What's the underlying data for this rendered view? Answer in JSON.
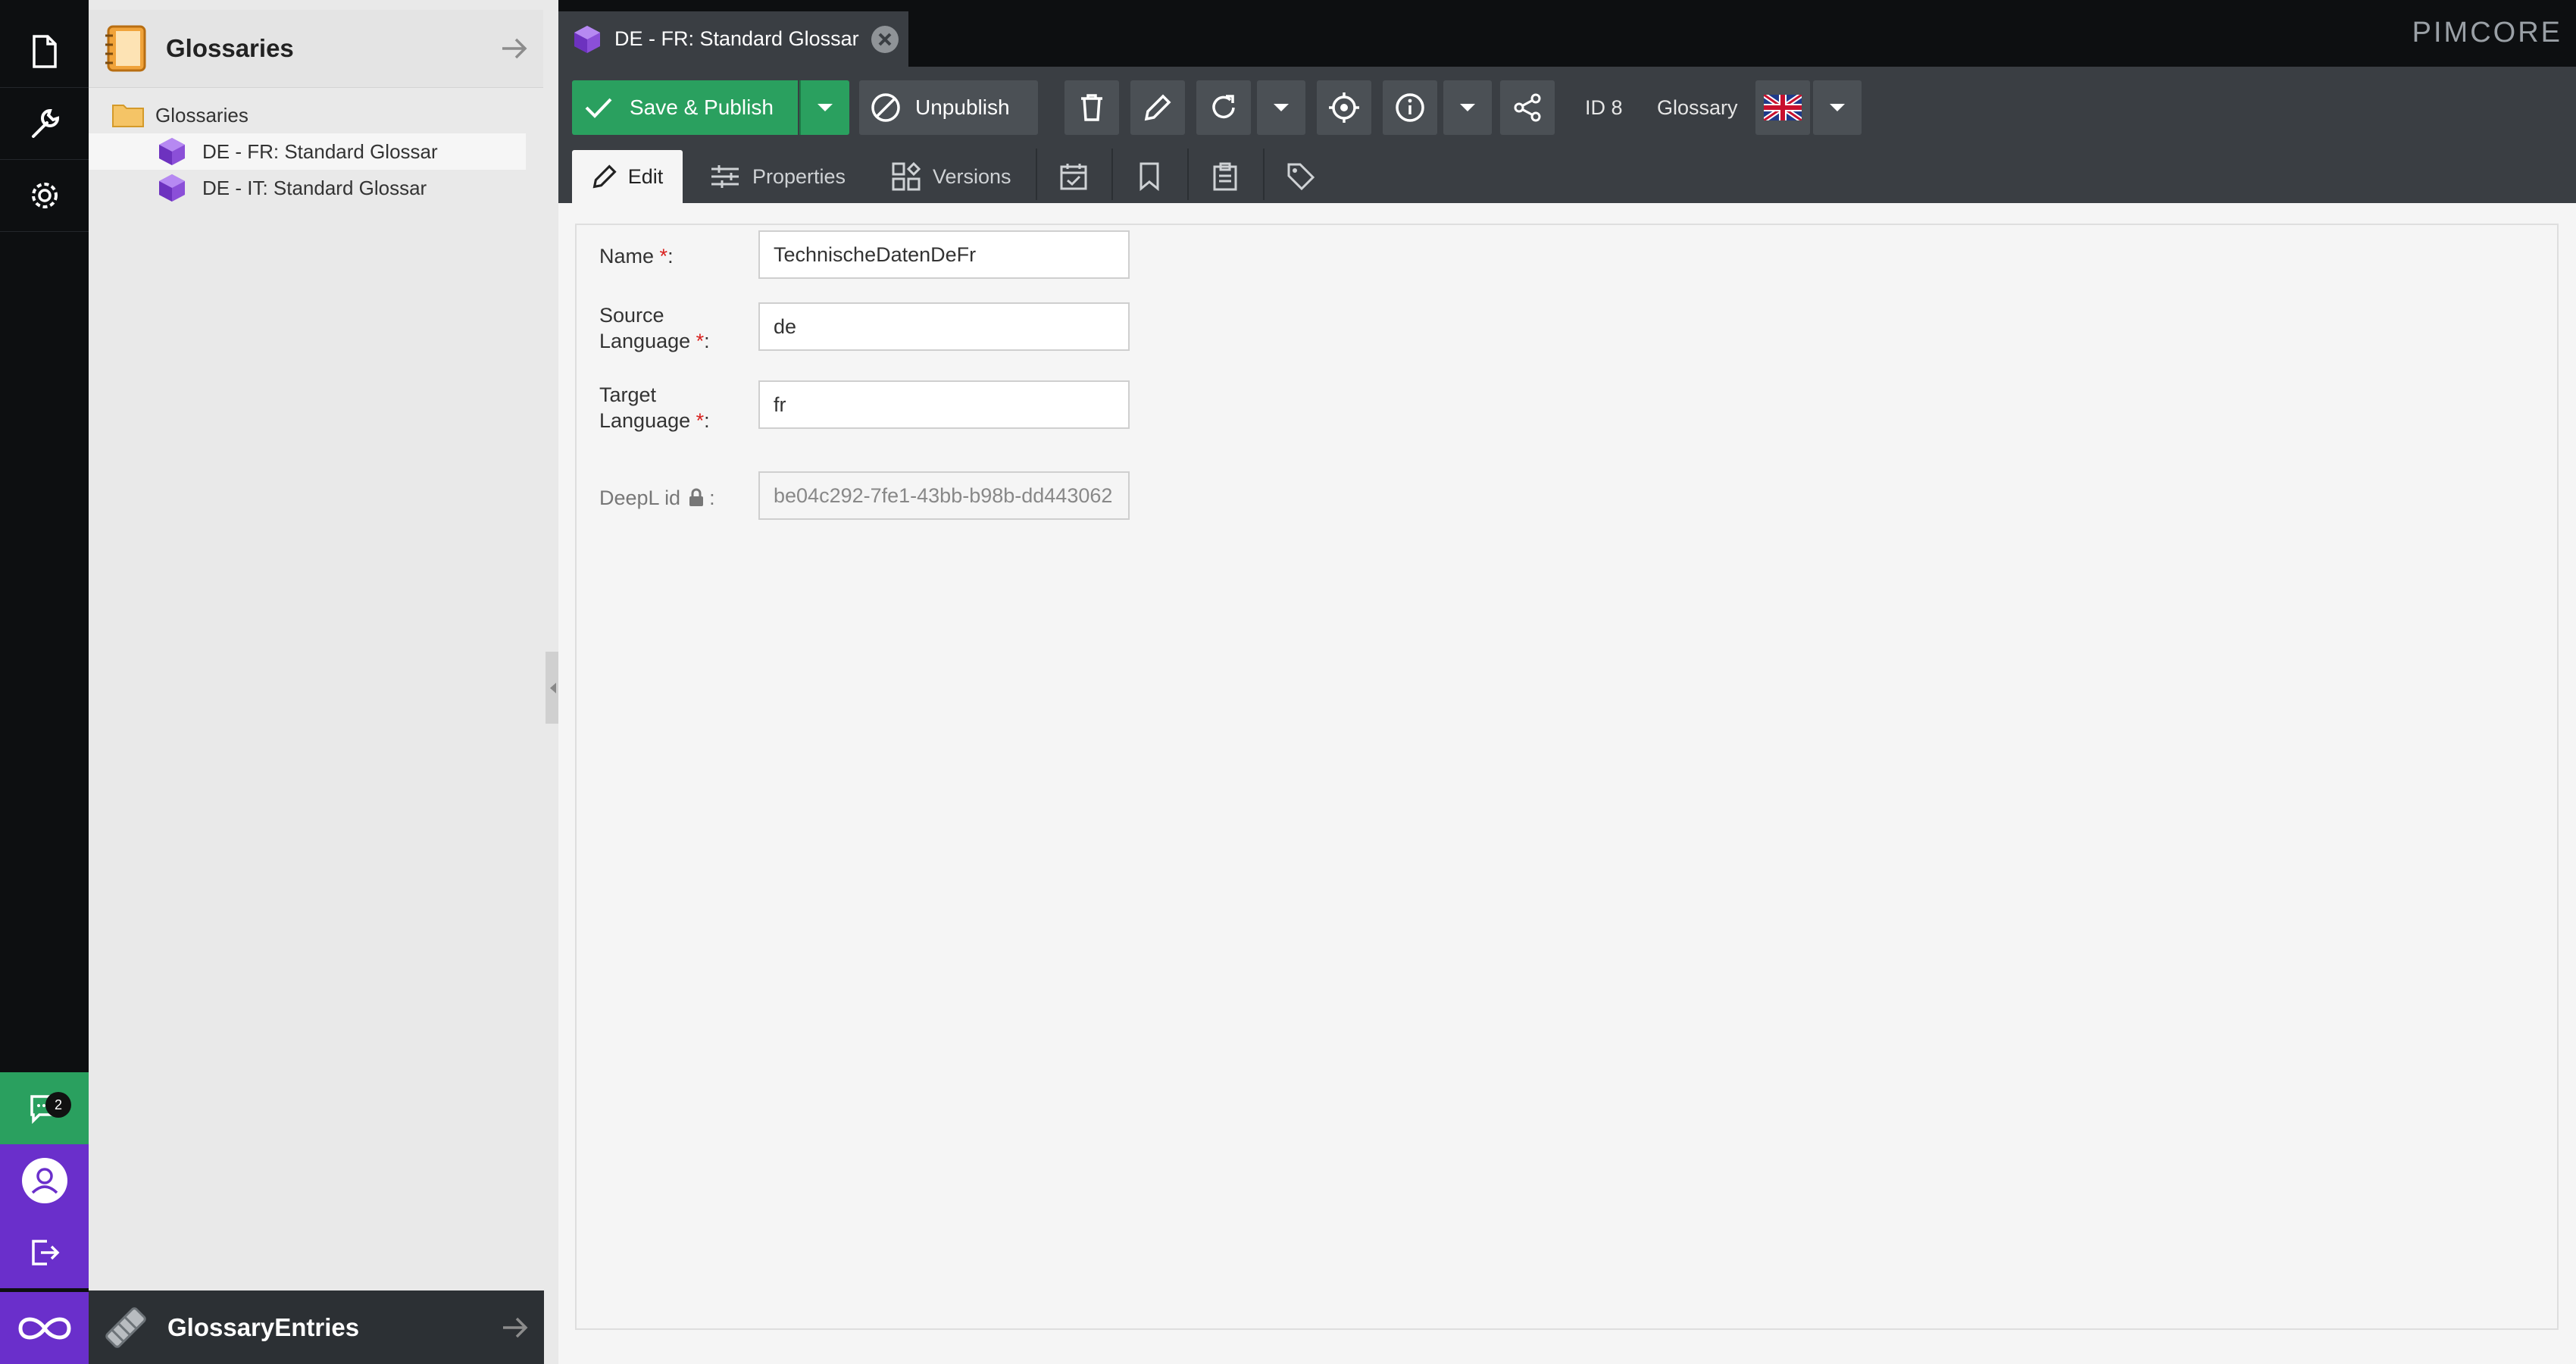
{
  "sidebar": {
    "chat_badge": "2"
  },
  "tree": {
    "title": "Glossaries",
    "folder_label": "Glossaries",
    "items": [
      {
        "label": "DE - FR: Standard Glossar"
      },
      {
        "label": "DE - IT: Standard Glossar"
      }
    ],
    "bottom_title": "GlossaryEntries"
  },
  "editor": {
    "tab_label": "DE - FR: Standard Glossar",
    "logo": "PIMCORE"
  },
  "toolbar": {
    "save_publish_label": "Save & Publish",
    "unpublish_label": "Unpublish",
    "id_label": "ID 8",
    "type_label": "Glossary"
  },
  "tabs": {
    "edit": "Edit",
    "properties": "Properties",
    "versions": "Versions"
  },
  "form": {
    "name_label": "Name",
    "name_value": "TechnischeDatenDeFr",
    "source_label_1": "Source",
    "source_label_2": "Language",
    "source_value": "de",
    "target_label_1": "Target",
    "target_label_2": "Language",
    "target_value": "fr",
    "deepl_label": "DeepL id",
    "deepl_value": "be04c292-7fe1-43bb-b98b-dd443062"
  },
  "colors": {
    "accent_green": "#2aa05f",
    "accent_purple": "#6a2fcb",
    "dark_bg": "#0d0f11",
    "toolbar_bg": "#3a3e43"
  }
}
